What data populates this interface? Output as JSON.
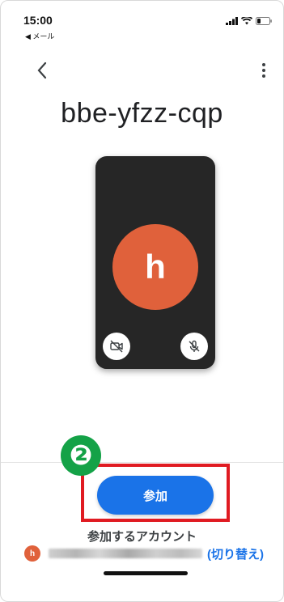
{
  "status_bar": {
    "time": "15:00",
    "back_app": "◀ メール"
  },
  "meeting": {
    "code": "bbe-yfzz-cqp",
    "avatar_initial": "h"
  },
  "annotation": {
    "step_number": "❷"
  },
  "actions": {
    "join_label": "参加",
    "join_account_label": "参加するアカウント",
    "account_initial": "h",
    "switch_label": "(切り替え)"
  },
  "icons": {
    "back": "chevron-left-icon",
    "more": "more-vert-icon",
    "camera_off": "videocam-off-icon",
    "mic_off": "mic-off-icon",
    "signal": "signal-icon",
    "wifi": "wifi-icon",
    "battery": "battery-icon"
  },
  "colors": {
    "accent": "#1a73e8",
    "avatar": "#e0613b",
    "highlight": "#e01b22",
    "step_badge": "#14a247",
    "preview_bg": "#262626"
  }
}
